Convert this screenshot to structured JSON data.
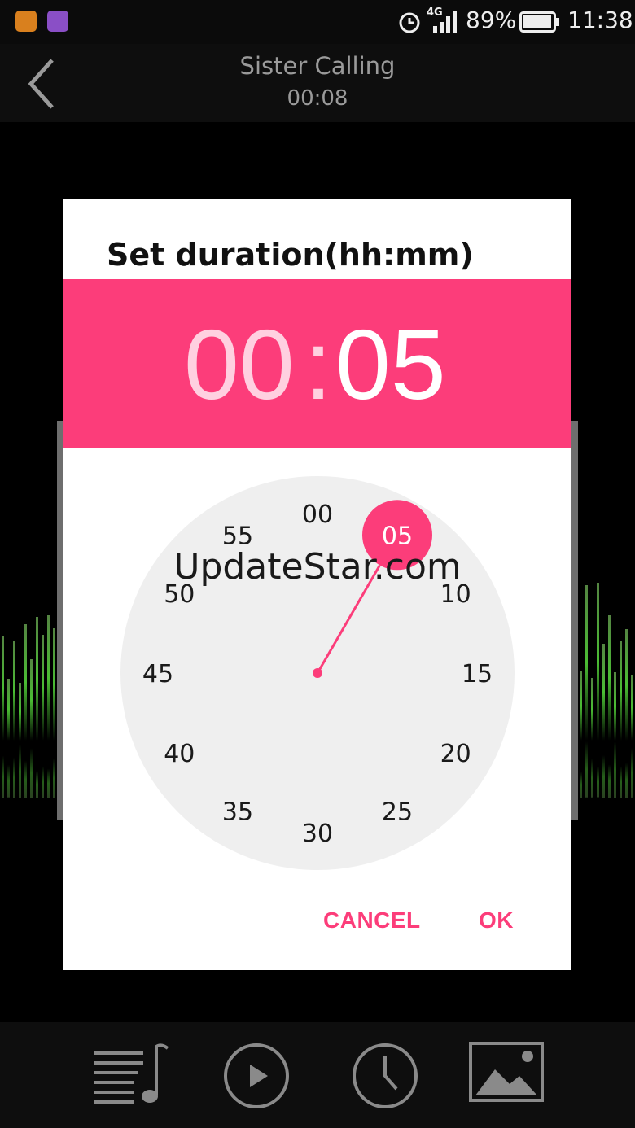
{
  "status_bar": {
    "network": "4G",
    "battery": "89%",
    "time": "11:38"
  },
  "header": {
    "title": "Sister Calling",
    "elapsed": "00:08"
  },
  "dialog": {
    "title": "Set duration(hh:mm)",
    "hours": "00",
    "colon": ":",
    "minutes": "05",
    "dial": {
      "labels": [
        "00",
        "05",
        "10",
        "15",
        "20",
        "25",
        "30",
        "35",
        "40",
        "45",
        "50",
        "55"
      ],
      "selected": "05"
    },
    "watermark": "UpdateStar.com",
    "cancel_label": "CANCEL",
    "ok_label": "OK"
  },
  "bottom_nav": [
    "playlist-icon",
    "play-icon",
    "clock-icon",
    "image-icon"
  ],
  "colors": {
    "accent": "#fc3d7a",
    "dial_bg": "#efefef",
    "dialog_bg": "#ffffff"
  }
}
